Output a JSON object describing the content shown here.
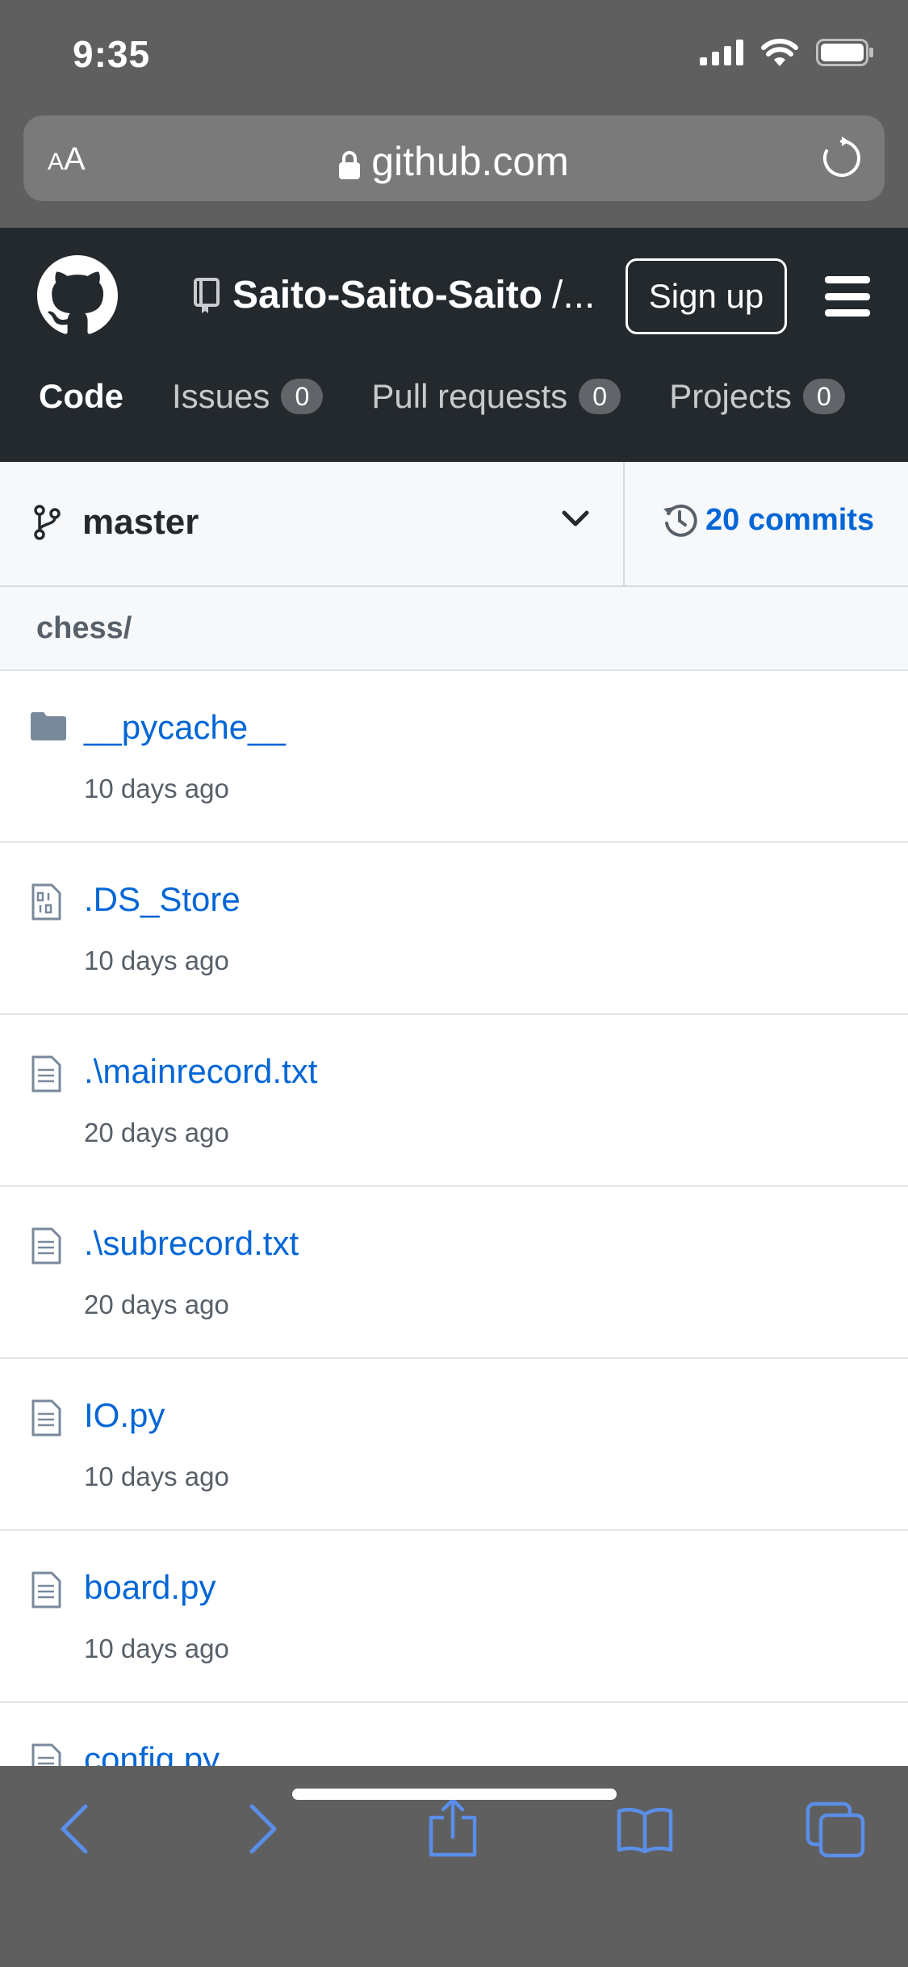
{
  "status_bar": {
    "time": "9:35"
  },
  "browser": {
    "text_size_label_small": "A",
    "text_size_label_large": "A",
    "url": "github.com"
  },
  "header": {
    "repo_owner": "Saito-Saito-Saito",
    "repo_separator": "/...",
    "signup_label": "Sign up",
    "tabs": [
      {
        "label": "Code",
        "count": null
      },
      {
        "label": "Issues",
        "count": "0"
      },
      {
        "label": "Pull requests",
        "count": "0"
      },
      {
        "label": "Projects",
        "count": "0"
      }
    ]
  },
  "branch": {
    "name": "master",
    "commits_label": "20 commits"
  },
  "path": "chess/",
  "files": [
    {
      "name": "__pycache__",
      "age": "10 days ago",
      "icon": "folder-icon"
    },
    {
      "name": ".DS_Store",
      "age": "10 days ago",
      "icon": "binary-file-icon"
    },
    {
      "name": ".\\mainrecord.txt",
      "age": "20 days ago",
      "icon": "file-icon"
    },
    {
      "name": ".\\subrecord.txt",
      "age": "20 days ago",
      "icon": "file-icon"
    },
    {
      "name": "IO.py",
      "age": "10 days ago",
      "icon": "file-icon"
    },
    {
      "name": "board.py",
      "age": "10 days ago",
      "icon": "file-icon"
    },
    {
      "name": "config.py",
      "age": "",
      "icon": "file-icon"
    }
  ],
  "colors": {
    "header_bg": "#24292e",
    "link_blue": "#0366d6",
    "safari_chrome": "#5f5f5f",
    "toolbar_icon": "#5a8ee8"
  }
}
